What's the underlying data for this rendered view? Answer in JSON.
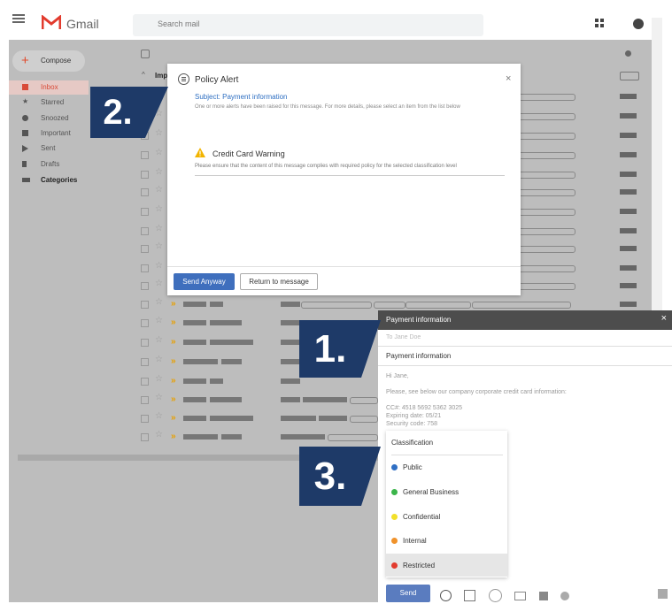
{
  "app": {
    "name": "Gmail",
    "search_placeholder": "Search mail"
  },
  "sidebar": {
    "compose_label": "Compose",
    "items": [
      {
        "label": "Inbox",
        "icon": "inbox-icon"
      },
      {
        "label": "Starred",
        "icon": "star-icon"
      },
      {
        "label": "Snoozed",
        "icon": "clock-icon"
      },
      {
        "label": "Important",
        "icon": "important-icon"
      },
      {
        "label": "Sent",
        "icon": "send-icon"
      },
      {
        "label": "Drafts",
        "icon": "draft-icon"
      },
      {
        "label": "Categories",
        "icon": "label-icon"
      }
    ]
  },
  "inbox": {
    "section_label": "Imp"
  },
  "policy_alert": {
    "title": "Policy Alert",
    "subject": "Subject: Payment information",
    "description": "One or more alerts have been raised for this message. For more details, please select an item from the list below",
    "warning_title": "Credit Card Warning",
    "warning_text": "Please ensure that the content of this message complies with required policy for the selected classification level",
    "send_anyway": "Send Anyway",
    "return_to_message": "Return to message",
    "close": "×"
  },
  "compose_window": {
    "title": "Payment information",
    "close": "×",
    "to": "To  Jane Doe",
    "subject": "Payment information",
    "body": "Hi Jane,\n\nPlease, see below our company corporate credit card information:\n\nCC#: 4518 5692 5362 3025\nExpiring date: 05/21\nSecurity code: 758",
    "send_label": "Send"
  },
  "classification": {
    "title": "Classification",
    "options": [
      {
        "label": "Public",
        "color": "#2f6fc4"
      },
      {
        "label": "General Business",
        "color": "#3bb54a"
      },
      {
        "label": "Confidential",
        "color": "#f2e02a"
      },
      {
        "label": "Internal",
        "color": "#f0922b"
      },
      {
        "label": "Restricted",
        "color": "#e23b2e"
      }
    ],
    "highlighted": "Restricted"
  },
  "callouts": [
    "1.",
    "2.",
    "3."
  ]
}
